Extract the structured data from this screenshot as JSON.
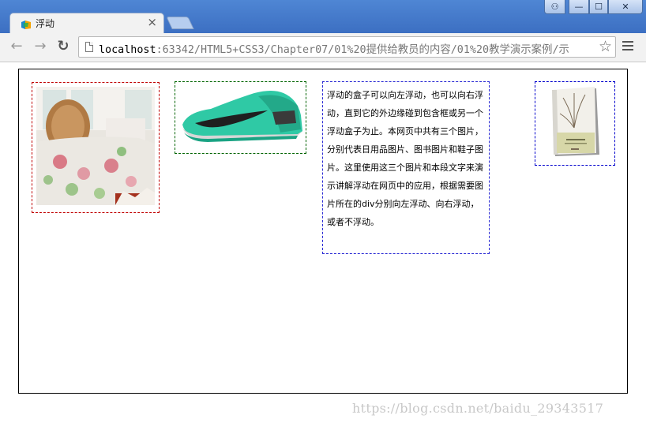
{
  "tab": {
    "title": "浮动",
    "close_label": "×"
  },
  "window": {
    "user_label": "⚇",
    "min_label": "—",
    "max_label": "☐",
    "close_label": "✕"
  },
  "toolbar": {
    "back_label": "←",
    "forward_label": "→",
    "reload_label": "↻",
    "url_host": "localhost",
    "url_rest": ":63342/HTML5+CSS3/Chapter07/01%20提供给教员的内容/01%20教学演示案例/示",
    "star_label": "☆"
  },
  "content": {
    "paragraph": "浮动的盒子可以向左浮动，也可以向右浮动，直到它的外边缘碰到包含框或另一个浮动盒子为止。本网页中共有三个图片，分别代表日用品图片、图书图片和鞋子图片。这里使用这三个图片和本段文字来演示讲解浮动在网页中的应用，根据需要图片所在的div分别向左浮动、向右浮动，或者不浮动。"
  },
  "watermark": "https://blog.csdn.net/baidu_29343517",
  "colors": {
    "bed_border": "#c00000",
    "shoe_border": "#006400",
    "text_border": "#2b2bd4",
    "book_border": "#0000cc",
    "shoe_body": "#2fc9a5"
  }
}
